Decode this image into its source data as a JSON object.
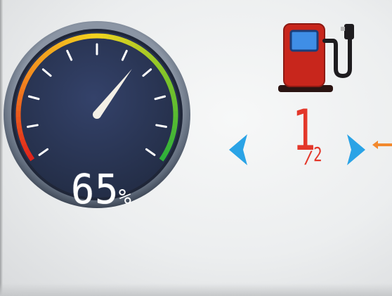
{
  "fuel_gauge": {
    "level_percent": 65,
    "value_text": "65",
    "unit": "%",
    "needle_angle_fraction": 0.65,
    "colors": {
      "dial_face": "#2c3855",
      "rim": "#6f7b8c",
      "tick": "#ffffff",
      "needle": "#f3efe6",
      "arc_gradient": [
        "#e0241b",
        "#f28a1f",
        "#f3d51f",
        "#7fc42a",
        "#2fb13a"
      ]
    }
  },
  "pump_icon": {
    "name": "fuel-pump-icon",
    "colors": {
      "body": "#c8261c",
      "window": "#3f8ee6",
      "base": "#2b1412",
      "hose": "#1e1c1f"
    }
  },
  "fuel_fraction": {
    "whole": "1",
    "slash": "/",
    "part": "2",
    "color": "#e3372a"
  },
  "navigation": {
    "prev_icon": "chevron-left-icon",
    "next_icon": "chevron-right-icon",
    "arrow_color": "#2aa3e6",
    "pointer_color": "#f2892e"
  }
}
